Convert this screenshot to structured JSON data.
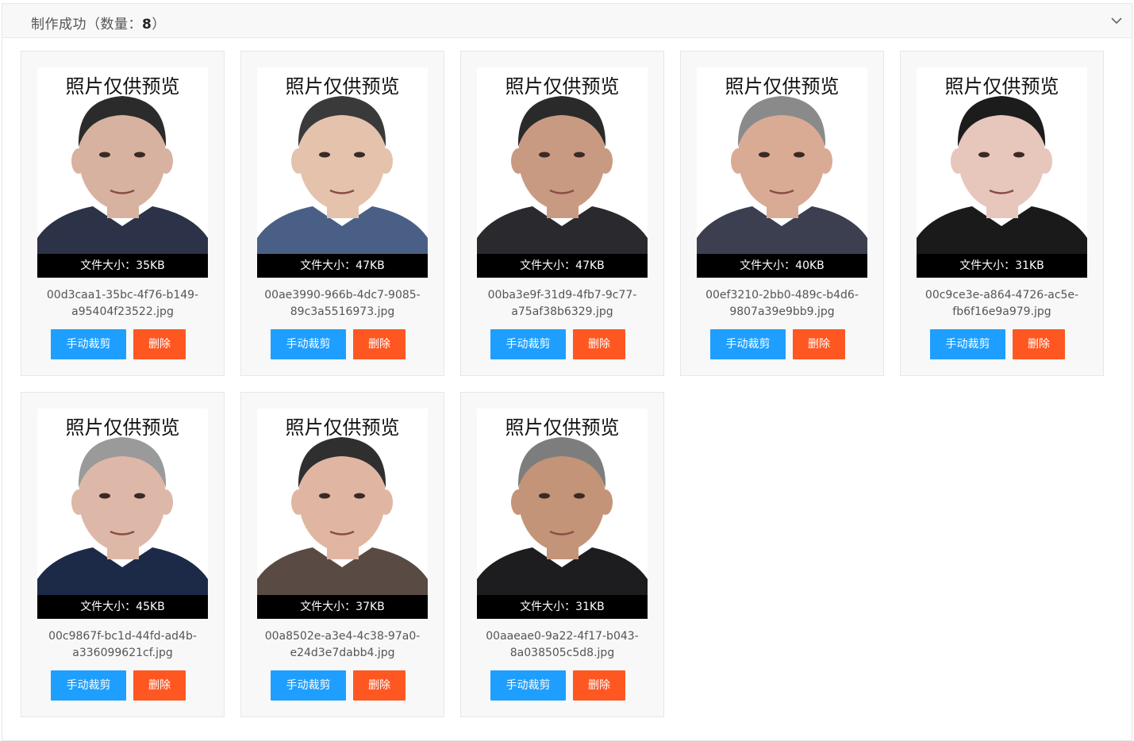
{
  "panel": {
    "title_prefix": "制作成功（数量：",
    "count": "8",
    "title_suffix": "）"
  },
  "watermark": "照片仅供预览",
  "buttons": {
    "crop": "手动裁剪",
    "delete": "删除"
  },
  "colors": {
    "crop": "#1e9fff",
    "delete": "#ff5722"
  },
  "cards": [
    {
      "size": "文件大小：35KB",
      "file1": "00d3caa1-35bc-4f76-b149-",
      "file2": "a95404f23522.jpg",
      "hair": "#2b2b2b",
      "skin": "#d8b2a0",
      "cloth": "#2c3348"
    },
    {
      "size": "文件大小：47KB",
      "file1": "00ae3990-966b-4dc7-9085-",
      "file2": "89c3a5516973.jpg",
      "hair": "#3a3a3a",
      "skin": "#e4c2ac",
      "cloth": "#4a5f86"
    },
    {
      "size": "文件大小：47KB",
      "file1": "00ba3e9f-31d9-4fb7-9c77-",
      "file2": "a75af38b6329.jpg",
      "hair": "#2a2a2a",
      "skin": "#c99a82",
      "cloth": "#2a2a2e"
    },
    {
      "size": "文件大小：40KB",
      "file1": "00ef3210-2bb0-489c-b4d6-",
      "file2": "9807a39e9bb9.jpg",
      "hair": "#8a8a8a",
      "skin": "#d9ab95",
      "cloth": "#3b3f50"
    },
    {
      "size": "文件大小：31KB",
      "file1": "00c9ce3e-a864-4726-ac5e-",
      "file2": "fb6f16e9a979.jpg",
      "hair": "#1c1c1c",
      "skin": "#e7c6bc",
      "cloth": "#1a1a1a"
    },
    {
      "size": "文件大小：45KB",
      "file1": "00c9867f-bc1d-44fd-ad4b-",
      "file2": "a336099621cf.jpg",
      "hair": "#9a9a9a",
      "skin": "#ddb8a8",
      "cloth": "#1d2a47"
    },
    {
      "size": "文件大小：37KB",
      "file1": "00a8502e-a3e4-4c38-97a0-",
      "file2": "e24d3e7dabb4.jpg",
      "hair": "#2f2f2f",
      "skin": "#e0b6a2",
      "cloth": "#5a4a44"
    },
    {
      "size": "文件大小：31KB",
      "file1": "00aaeae0-9a22-4f17-b043-",
      "file2": "8a038505c5d8.jpg",
      "hair": "#7d7d7d",
      "skin": "#c39478",
      "cloth": "#1d1d1f"
    }
  ]
}
